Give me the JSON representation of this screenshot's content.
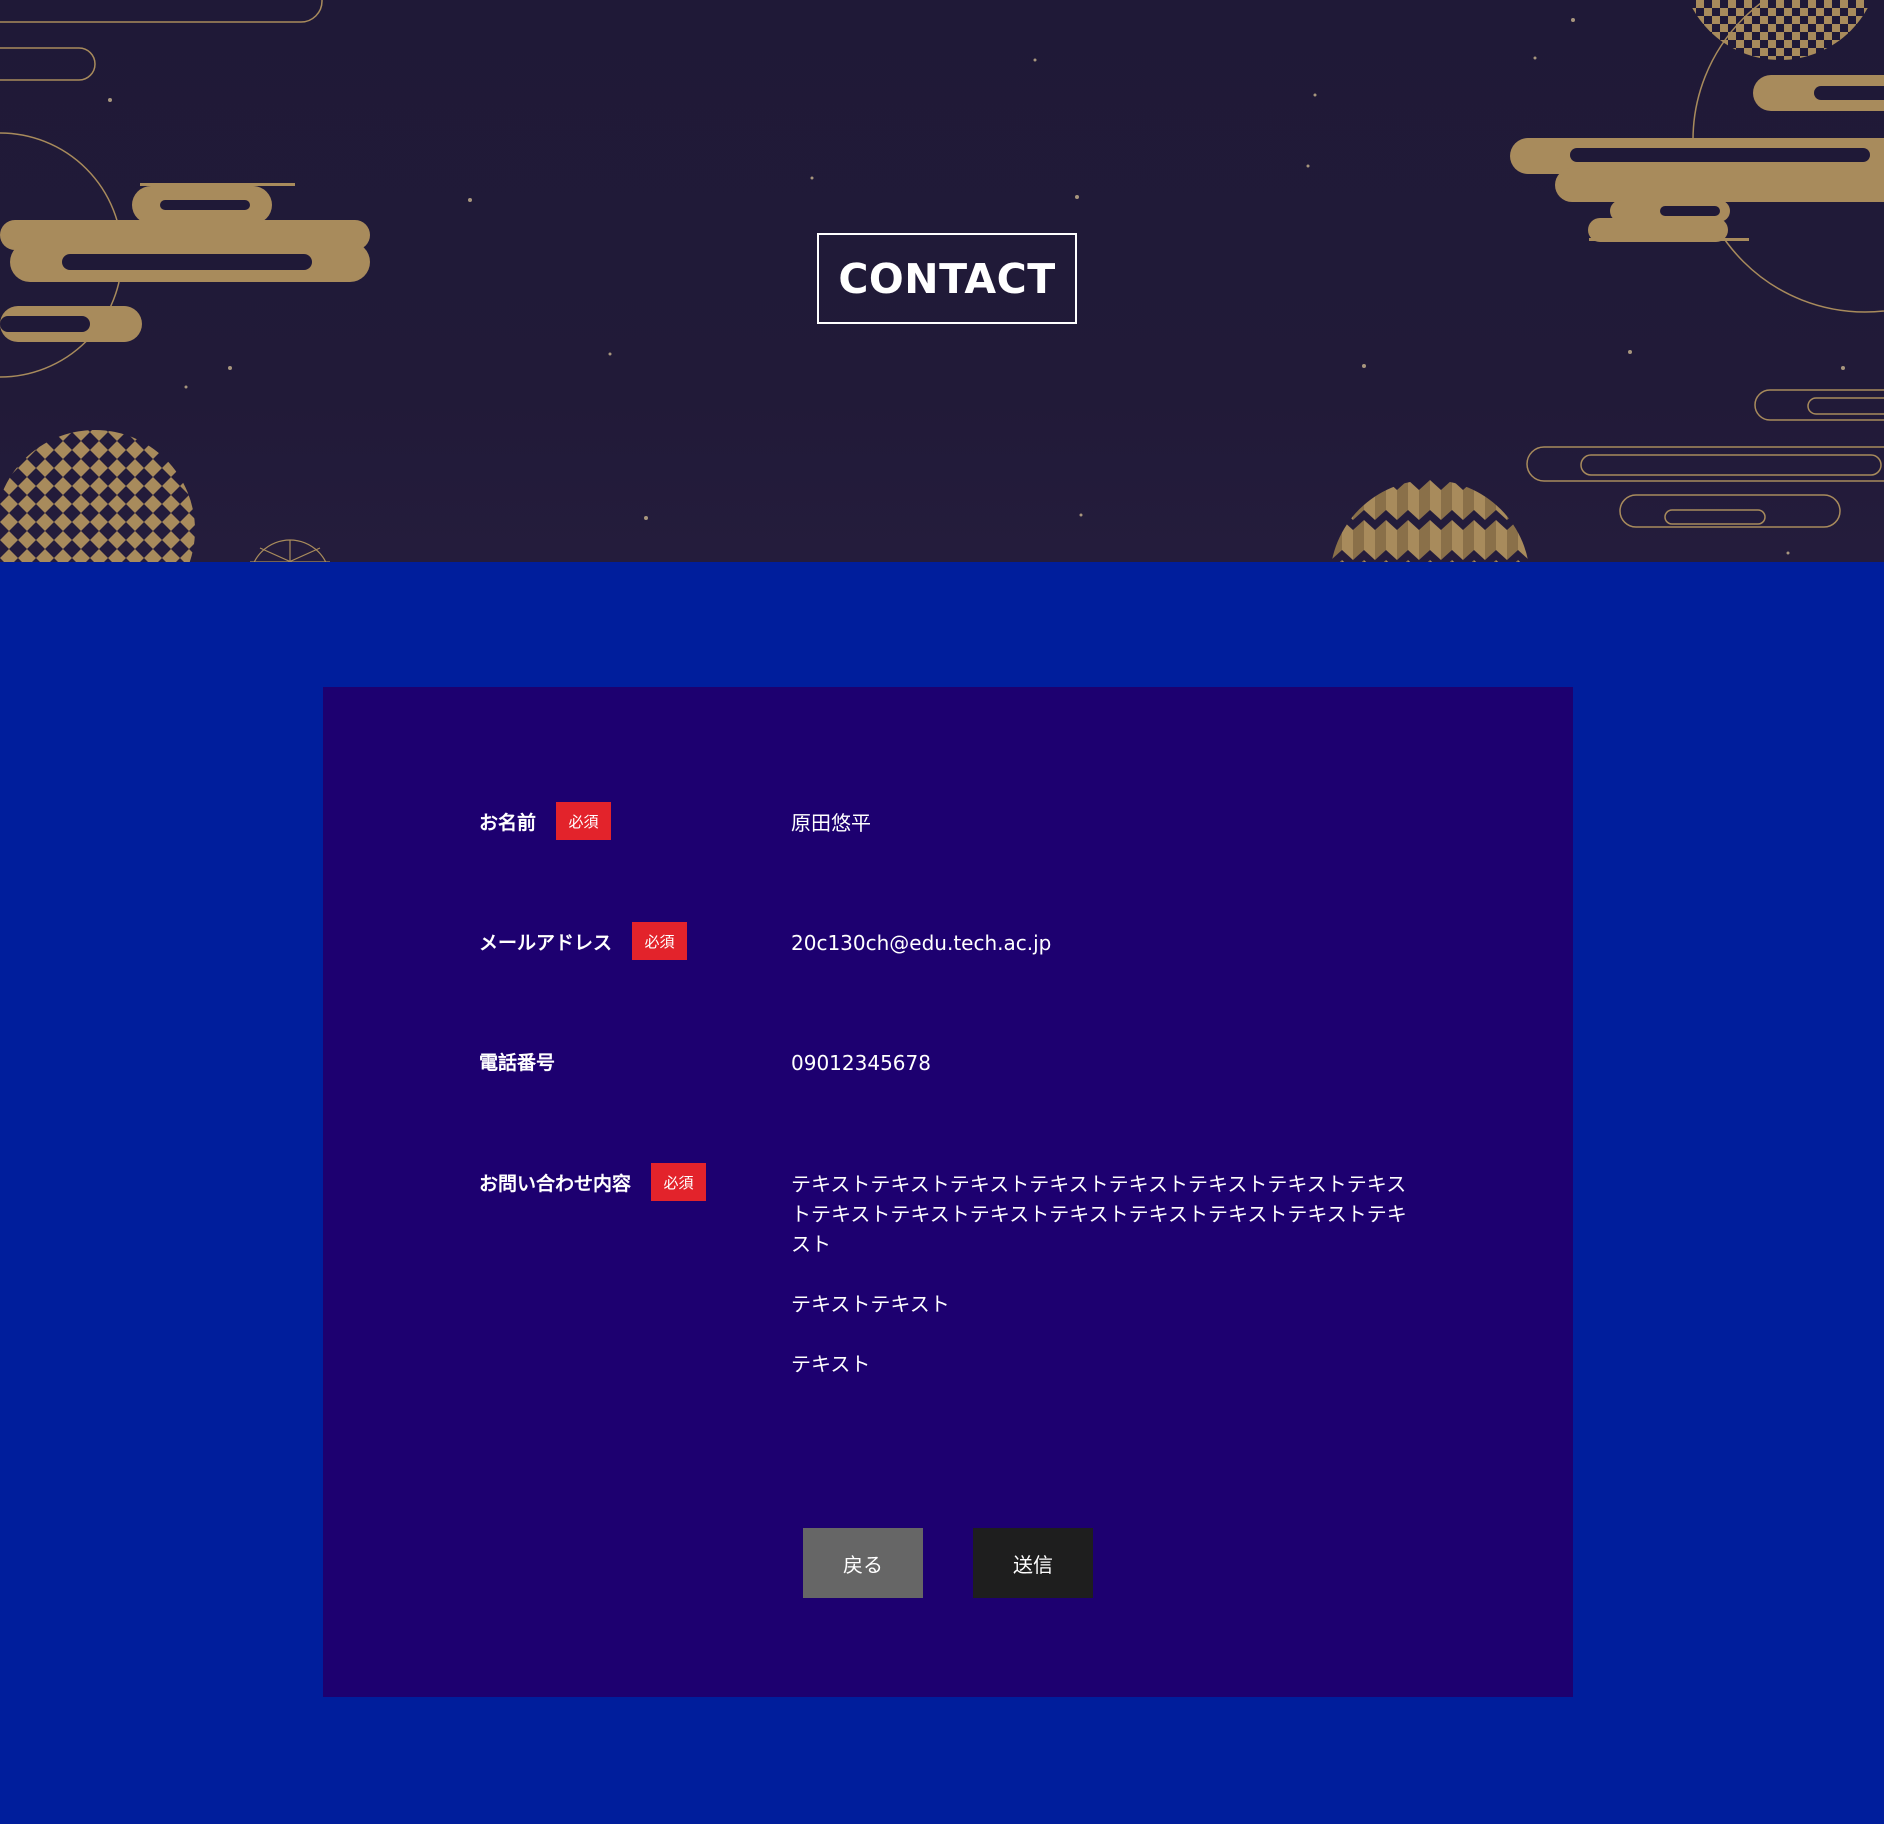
{
  "hero": {
    "title": "CONTACT"
  },
  "form": {
    "required_badge": "必須",
    "fields": [
      {
        "label": "お名前",
        "required": true,
        "value": "原田悠平"
      },
      {
        "label": "メールアドレス",
        "required": true,
        "value": "20c130ch@edu.tech.ac.jp"
      },
      {
        "label": "電話番号",
        "required": false,
        "value": "09012345678"
      },
      {
        "label": "お問い合わせ内容",
        "required": true,
        "value": "テキストテキストテキストテキストテキストテキストテキストテキストテキストテキストテキストテキストテキストテキストテキストテキスト",
        "extra_lines": [
          "テキストテキスト",
          "テキスト"
        ]
      }
    ],
    "buttons": {
      "back_label": "戻る",
      "send_label": "送信"
    }
  },
  "colors": {
    "hero_bg": "#1f1937",
    "page_bg": "#001e9c",
    "panel_bg": "#1d0070",
    "required_badge": "#e3232b",
    "back_button": "#666666",
    "send_button": "#1e1e1e",
    "gold_ornament": "#a88b5c"
  }
}
